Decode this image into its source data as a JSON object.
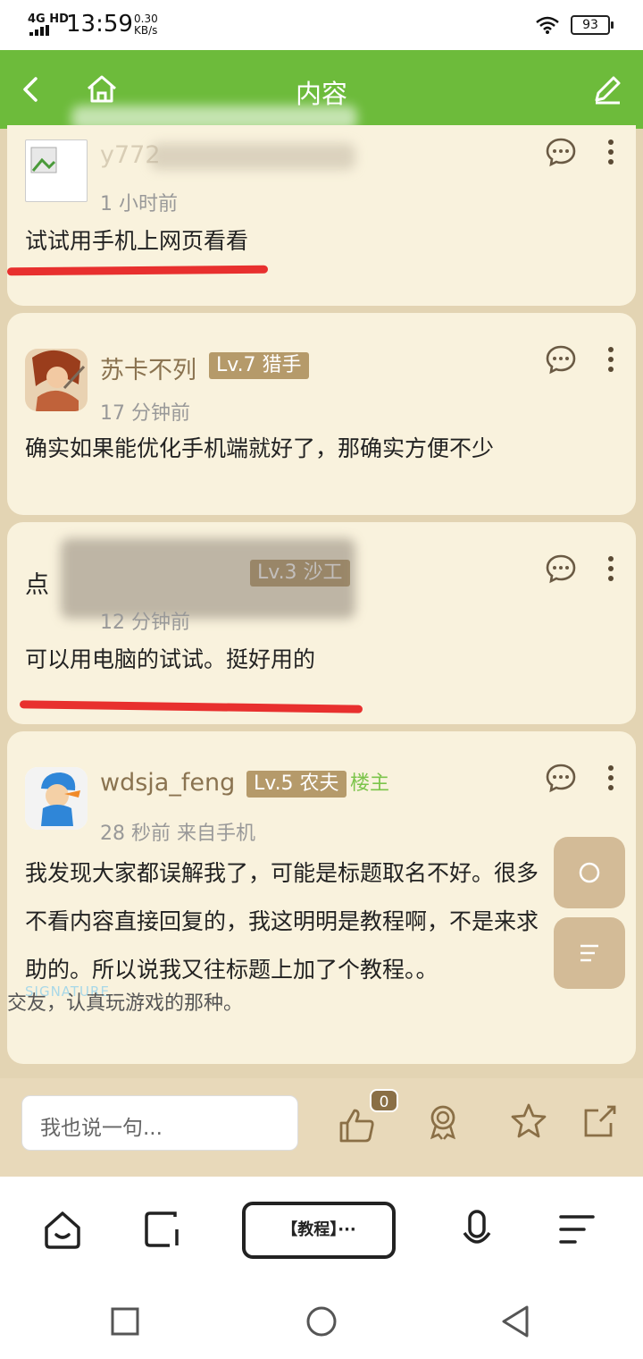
{
  "status_bar": {
    "network": "4G HD",
    "time": "13:59",
    "speed_value": "0.30",
    "speed_unit": "KB/s",
    "battery": "93"
  },
  "header": {
    "title": "内容",
    "color": "#6dbb3b",
    "icons": [
      "back-icon",
      "home-icon",
      "edit-icon"
    ]
  },
  "posts": [
    {
      "username": "y772",
      "level": "",
      "time": "1 小时前",
      "lines": [
        "试试用手机上网页看看"
      ]
    },
    {
      "username": "苏卡不列",
      "level": "Lv.7 猎手",
      "time": "17 分钟前",
      "lines": [
        "确实如果能优化手机端就好了，那确实方便不少"
      ]
    },
    {
      "username": "点",
      "level": "Lv.3  沙工",
      "time": "12 分钟前",
      "lines": [
        "可以用电脑的试试。挺好用的"
      ]
    },
    {
      "username": "wdsja_feng",
      "level": "Lv.5 农夫",
      "owner_tag": "楼主",
      "time": "28 秒前  来自手机",
      "lines": [
        "我发现大家都误解我了，可能是标题取名不好。很多",
        "不看内容直接回复的，我这明明是教程啊，不是来求",
        "助的。所以说我又往标题上加了个教程。。"
      ],
      "signature_label": "SIGNATURE",
      "signature": "交友，认真玩游戏的那种。"
    }
  ],
  "reply_bar": {
    "placeholder": "我也说一句...",
    "like_count": "0",
    "icons": [
      "like-icon",
      "award-icon",
      "favorite-icon",
      "share-icon"
    ]
  },
  "browser_bar": {
    "tab_label": "【教程】···",
    "icons": [
      "home-icon",
      "tabs-icon",
      "mic-icon",
      "menu-icon"
    ]
  },
  "colors": {
    "accent_green": "#6dbb3b",
    "card_bg": "#f9f2dd",
    "page_bg": "#e3d4b3",
    "level_badge": "#b59a6a",
    "highlight_red": "#e8302e"
  }
}
